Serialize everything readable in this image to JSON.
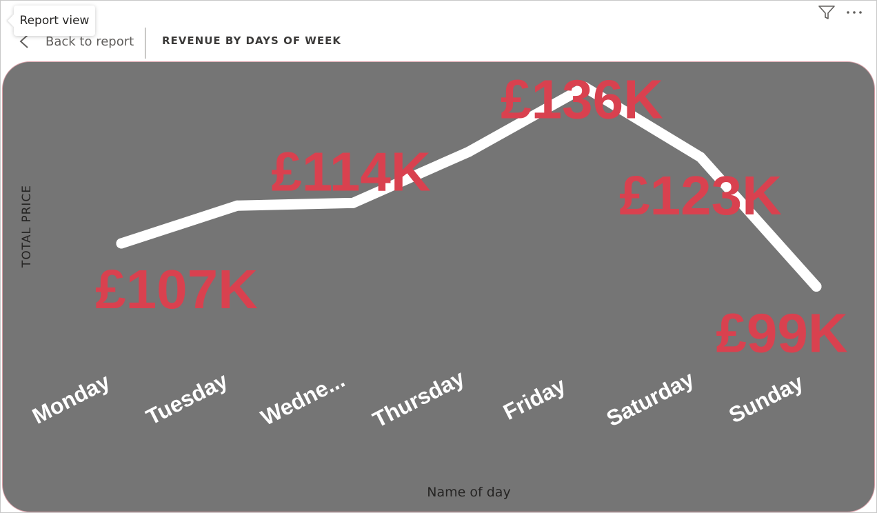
{
  "tooltip": {
    "label": "Report view"
  },
  "header": {
    "back_label": "Back to report",
    "title": "REVENUE BY DAYS OF WEEK"
  },
  "icons": {
    "filter": "filter-icon",
    "more": "more-options-icon",
    "back": "chevron-left-icon"
  },
  "colors": {
    "card": "#757575",
    "line": "#ffffff",
    "data_label": "#d9414f",
    "axis_text": "#ffffff",
    "axis_title": "#252423"
  },
  "chart_data": {
    "type": "line",
    "title": "REVENUE BY DAYS OF WEEK",
    "xlabel": "Name of day",
    "ylabel": "TOTAL PRICE",
    "categories": [
      "Monday",
      "Tuesday",
      "Wedne...",
      "Thursday",
      "Friday",
      "Saturday",
      "Sunday"
    ],
    "series": [
      {
        "values": [
          107,
          114,
          114.5,
          124,
          136,
          123,
          99
        ],
        "data_labels": [
          "£107K",
          "",
          "£114K",
          "",
          "£136K",
          "£123K",
          "£99K"
        ]
      }
    ],
    "ylim": [
      85,
      140
    ],
    "grid": false,
    "legend": "none"
  }
}
